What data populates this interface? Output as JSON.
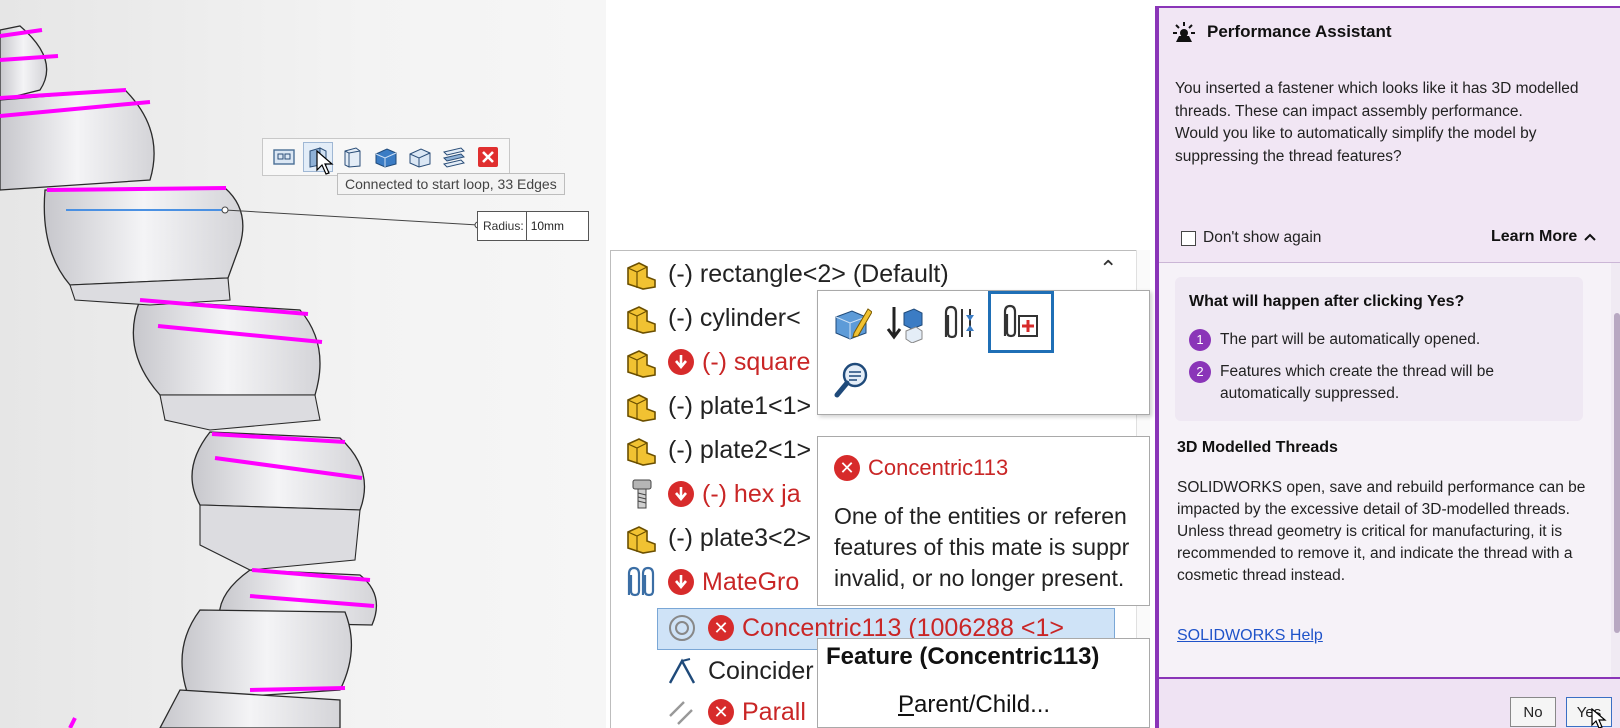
{
  "viewport": {
    "toolbar_icons": [
      "select-loop-icon",
      "select-partial-loop-icon",
      "select-face-icon",
      "select-tangency-icon",
      "select-feature-icon",
      "select-connected-icon",
      "close-icon"
    ],
    "tooltip": "Connected to start loop, 33 Edges",
    "radius_label": "Radius:",
    "radius_value": "10mm",
    "edge_color": "#ff00ff",
    "selected_edge_color": "#4a90e2"
  },
  "tree": {
    "rows": [
      {
        "label": "(-) rectangle<2> (Default)",
        "icon": "assembly-component-icon",
        "error": false
      },
      {
        "label": "(-) cylinder<",
        "icon": "assembly-component-icon",
        "error": false
      },
      {
        "label": "(-) square",
        "icon": "assembly-component-icon",
        "error": true
      },
      {
        "label": "(-) plate1<1>",
        "icon": "assembly-component-icon",
        "error": false
      },
      {
        "label": "(-) plate2<1>",
        "icon": "assembly-component-icon",
        "error": false
      },
      {
        "label": "(-) hex ja",
        "icon": "fastener-icon",
        "error": true
      },
      {
        "label": "(-) plate3<2>",
        "icon": "assembly-component-icon",
        "error": false
      },
      {
        "label": "MateGro",
        "icon": "mates-folder-icon",
        "error": true
      },
      {
        "label": "Concentric113 (1006288 <1>",
        "icon": "concentric-mate-icon",
        "error": true
      },
      {
        "label": "Coincider",
        "icon": "coincident-mate-icon",
        "error": false
      },
      {
        "label": "Parall",
        "icon": "parallel-mate-icon",
        "error": true
      }
    ],
    "popup_icons": [
      "edit-part-icon",
      "insert-down-icon",
      "mate-reference-icon",
      "add-to-folder-icon",
      "zoom-to-selection-icon"
    ],
    "mate_tooltip": {
      "title": "Concentric113",
      "lines": [
        "One of the entities or referen",
        "features of this mate is suppr",
        "invalid, or no longer present."
      ]
    },
    "feature_menu": {
      "title": "Feature (Concentric113)",
      "item_underline": "P",
      "item_rest": "arent/Child..."
    }
  },
  "assistant": {
    "title": "Performance Assistant",
    "message": [
      "You inserted a fastener which looks like it has 3D modelled threads. These can impact assembly performance.",
      "Would you like to automatically simplify the model by suppressing the thread features?"
    ],
    "dont_show": "Don't show again",
    "learn_more": "Learn More",
    "card_title": "What will happen after clicking Yes?",
    "steps": [
      {
        "num": "1",
        "text": "The part will be automatically opened."
      },
      {
        "num": "2",
        "text": "Features which create the thread will be automatically suppressed."
      }
    ],
    "section_title": "3D Modelled Threads",
    "section_body": [
      "SOLIDWORKS open, save and rebuild performance can be impacted by the excessive detail of 3D-modelled threads.",
      "Unless thread geometry is critical for manufacturing, it is recommended to remove it, and indicate the thread with a cosmetic thread instead."
    ],
    "help_link": "SOLIDWORKS Help",
    "no_button": "No",
    "yes_button": "Yes",
    "accent_color": "#8a35b8"
  }
}
